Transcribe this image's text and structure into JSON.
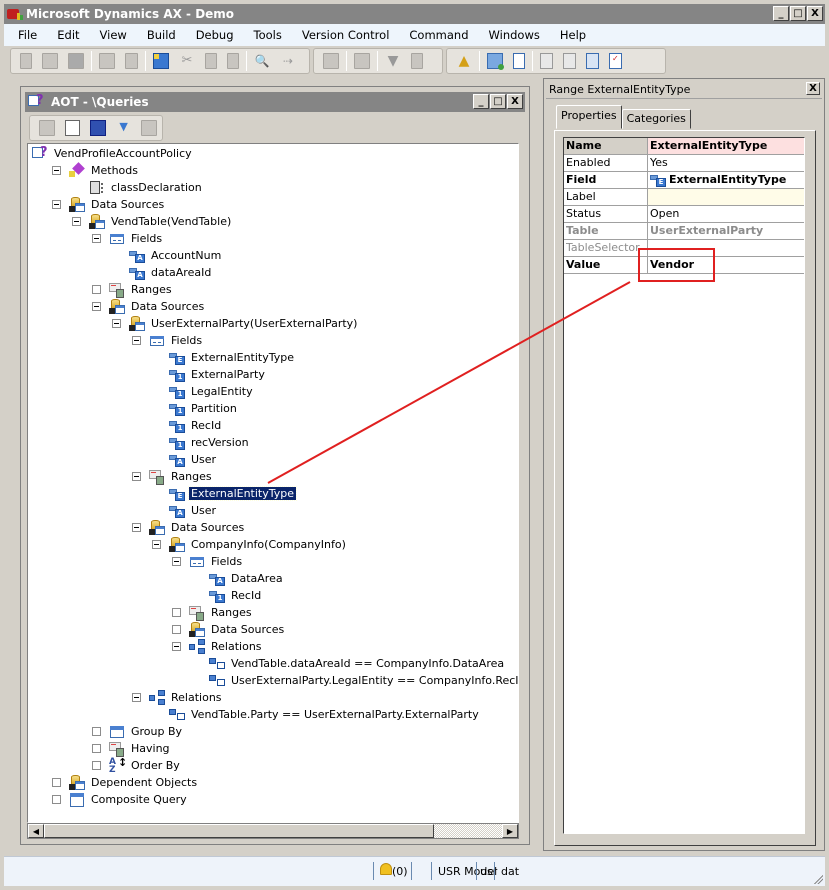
{
  "app": {
    "title": "Microsoft Dynamics AX - Demo",
    "window_buttons": {
      "minimize": "_",
      "maximize": "□",
      "close": "X"
    }
  },
  "menu": [
    {
      "label": "File"
    },
    {
      "label": "Edit"
    },
    {
      "label": "View"
    },
    {
      "label": "Build"
    },
    {
      "label": "Debug"
    },
    {
      "label": "Tools"
    },
    {
      "label": "Version Control"
    },
    {
      "label": "Command"
    },
    {
      "label": "Windows"
    },
    {
      "label": "Help"
    }
  ],
  "toolbar": {
    "icons": [
      "new-icon",
      "open-icon",
      "save-icon",
      "print-icon",
      "print-preview-icon",
      "new-window-icon",
      "cut-icon",
      "copy-icon",
      "paste-icon",
      "find-icon",
      "find-next-icon",
      "properties-icon",
      "import-icon",
      "filter-icon",
      "sort-icon",
      "alert-icon",
      "compare-icon",
      "list-icon",
      "debug-settings-icon",
      "breakpoints-icon",
      "call-stack-icon",
      "checklist-icon"
    ]
  },
  "aot": {
    "title": "AOT - \\Queries",
    "toolbar_icons": [
      "open-icon",
      "properties-icon",
      "save-all-icon",
      "filter-icon",
      "import-icon"
    ],
    "tree": [
      {
        "label": "VendProfileAccountPolicy",
        "depth": 0,
        "expander": "none",
        "icon": "query"
      },
      {
        "label": "Methods",
        "depth": 1,
        "expander": "minus",
        "icon": "methods"
      },
      {
        "label": "classDeclaration",
        "depth": 2,
        "expander": "none",
        "icon": "class"
      },
      {
        "label": "Data Sources",
        "depth": 1,
        "expander": "minus",
        "icon": "ds"
      },
      {
        "label": "VendTable(VendTable)",
        "depth": 2,
        "expander": "minus",
        "icon": "ds"
      },
      {
        "label": "Fields",
        "depth": 3,
        "expander": "minus",
        "icon": "fields"
      },
      {
        "label": "AccountNum",
        "depth": 4,
        "expander": "none",
        "icon": "field",
        "type": "A"
      },
      {
        "label": "dataAreaId",
        "depth": 4,
        "expander": "none",
        "icon": "field",
        "type": "A"
      },
      {
        "label": "Ranges",
        "depth": 3,
        "expander": "empty",
        "icon": "ranges"
      },
      {
        "label": "Data Sources",
        "depth": 3,
        "expander": "minus",
        "icon": "ds"
      },
      {
        "label": "UserExternalParty(UserExternalParty)",
        "depth": 4,
        "expander": "minus",
        "icon": "ds"
      },
      {
        "label": "Fields",
        "depth": 5,
        "expander": "minus",
        "icon": "fields"
      },
      {
        "label": "ExternalEntityType",
        "depth": 6,
        "expander": "none",
        "icon": "field",
        "type": "E"
      },
      {
        "label": "ExternalParty",
        "depth": 6,
        "expander": "none",
        "icon": "field",
        "type": "1"
      },
      {
        "label": "LegalEntity",
        "depth": 6,
        "expander": "none",
        "icon": "field",
        "type": "1"
      },
      {
        "label": "Partition",
        "depth": 6,
        "expander": "none",
        "icon": "field",
        "type": "1"
      },
      {
        "label": "RecId",
        "depth": 6,
        "expander": "none",
        "icon": "field",
        "type": "1"
      },
      {
        "label": "recVersion",
        "depth": 6,
        "expander": "none",
        "icon": "field",
        "type": "1"
      },
      {
        "label": "User",
        "depth": 6,
        "expander": "none",
        "icon": "field",
        "type": "A"
      },
      {
        "label": "Ranges",
        "depth": 5,
        "expander": "minus",
        "icon": "ranges"
      },
      {
        "label": "ExternalEntityType",
        "depth": 6,
        "expander": "none",
        "icon": "field",
        "type": "E",
        "selected": true
      },
      {
        "label": "User",
        "depth": 6,
        "expander": "none",
        "icon": "field",
        "type": "A"
      },
      {
        "label": "Data Sources",
        "depth": 5,
        "expander": "minus",
        "icon": "ds"
      },
      {
        "label": "CompanyInfo(CompanyInfo)",
        "depth": 6,
        "expander": "minus",
        "icon": "ds"
      },
      {
        "label": "Fields",
        "depth": 7,
        "expander": "minus",
        "icon": "fields"
      },
      {
        "label": "DataArea",
        "depth": 8,
        "expander": "none",
        "icon": "field",
        "type": "A"
      },
      {
        "label": "RecId",
        "depth": 8,
        "expander": "none",
        "icon": "field",
        "type": "1"
      },
      {
        "label": "Ranges",
        "depth": 7,
        "expander": "empty",
        "icon": "ranges"
      },
      {
        "label": "Data Sources",
        "depth": 7,
        "expander": "empty",
        "icon": "ds"
      },
      {
        "label": "Relations",
        "depth": 7,
        "expander": "minus",
        "icon": "rel"
      },
      {
        "label": "VendTable.dataAreaId == CompanyInfo.DataArea",
        "depth": 8,
        "expander": "none",
        "icon": "relitem"
      },
      {
        "label": "UserExternalParty.LegalEntity == CompanyInfo.RecId",
        "depth": 8,
        "expander": "none",
        "icon": "relitem"
      },
      {
        "label": "Relations",
        "depth": 5,
        "expander": "minus",
        "icon": "rel"
      },
      {
        "label": "VendTable.Party == UserExternalParty.ExternalParty",
        "depth": 6,
        "expander": "none",
        "icon": "relitem"
      },
      {
        "label": "Group By",
        "depth": 3,
        "expander": "empty",
        "icon": "groupby"
      },
      {
        "label": "Having",
        "depth": 3,
        "expander": "empty",
        "icon": "ranges"
      },
      {
        "label": "Order By",
        "depth": 3,
        "expander": "empty",
        "icon": "orderby"
      },
      {
        "label": "Dependent Objects",
        "depth": 1,
        "expander": "empty",
        "icon": "ds"
      },
      {
        "label": "Composite Query",
        "depth": 1,
        "expander": "empty",
        "icon": "composite"
      }
    ]
  },
  "properties": {
    "title": "Range ExternalEntityType",
    "tabs": [
      {
        "label": "Properties",
        "active": true
      },
      {
        "label": "Categories",
        "active": false
      }
    ],
    "rows": [
      {
        "name": "Name",
        "value": "ExternalEntityType",
        "style": "name"
      },
      {
        "name": "Enabled",
        "value": "Yes",
        "style": "normal"
      },
      {
        "name": "Field",
        "value": "ExternalEntityType",
        "style": "bold",
        "icon": "field-enum-icon"
      },
      {
        "name": "Label",
        "value": "",
        "style": "label"
      },
      {
        "name": "Status",
        "value": "Open",
        "style": "normal"
      },
      {
        "name": "Table",
        "value": "UserExternalParty",
        "style": "graybold"
      },
      {
        "name": "TableSelector",
        "value": "",
        "style": "gray"
      },
      {
        "name": "Value",
        "value": "Vendor",
        "style": "bold"
      }
    ]
  },
  "annotation": {
    "color": "#e02020",
    "from_node": "ExternalEntityType (Ranges)",
    "to_property": "Value"
  },
  "statusbar": {
    "notifications": "(0)",
    "model": "USR Model",
    "layer": "usr",
    "company": "dat"
  },
  "colors": {
    "titlebar": "#858585",
    "menubar": "#eef5fc",
    "selection": "#0a246a",
    "name_value_bg": "#fde0e0",
    "label_value_bg": "#fffce8"
  }
}
